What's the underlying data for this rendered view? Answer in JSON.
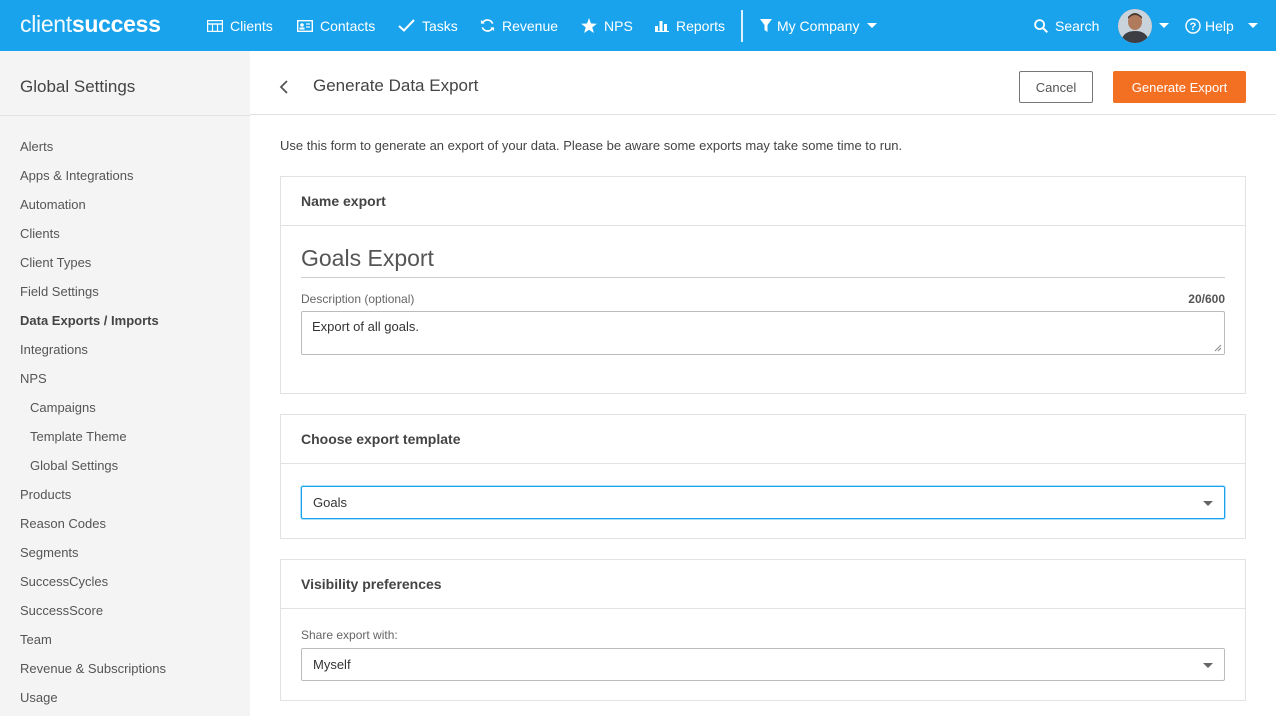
{
  "brand": {
    "part1": "client",
    "part2": "success"
  },
  "nav": {
    "clients": "Clients",
    "contacts": "Contacts",
    "tasks": "Tasks",
    "revenue": "Revenue",
    "nps": "NPS",
    "reports": "Reports",
    "company": "My Company",
    "search": "Search",
    "help": "Help"
  },
  "sidebar": {
    "title": "Global Settings",
    "items": [
      {
        "label": "Alerts"
      },
      {
        "label": "Apps & Integrations"
      },
      {
        "label": "Automation"
      },
      {
        "label": "Clients"
      },
      {
        "label": "Client Types"
      },
      {
        "label": "Field Settings"
      },
      {
        "label": "Data Exports / Imports",
        "active": true
      },
      {
        "label": "Integrations"
      },
      {
        "label": "NPS"
      },
      {
        "label": "Campaigns",
        "sub": true
      },
      {
        "label": "Template Theme",
        "sub": true
      },
      {
        "label": "Global Settings",
        "sub": true
      },
      {
        "label": "Products"
      },
      {
        "label": "Reason Codes"
      },
      {
        "label": "Segments"
      },
      {
        "label": "SuccessCycles"
      },
      {
        "label": "SuccessScore"
      },
      {
        "label": "Team"
      },
      {
        "label": "Revenue & Subscriptions"
      },
      {
        "label": "Usage"
      }
    ]
  },
  "header": {
    "title": "Generate Data Export",
    "cancel": "Cancel",
    "generate": "Generate Export"
  },
  "intro": "Use this form to generate an export of your data. Please be aware some exports may take some time to run.",
  "name_section": {
    "heading": "Name export",
    "name_value": "Goals Export",
    "description_label": "Description (optional)",
    "char_count": "20/600",
    "description_value": "Export of all goals."
  },
  "template_section": {
    "heading": "Choose export template",
    "selected": "Goals"
  },
  "visibility_section": {
    "heading": "Visibility preferences",
    "share_label": "Share export with:",
    "selected": "Myself"
  },
  "colors": {
    "topbar": "#1aa3ed",
    "primary_button": "#f36f21",
    "sidebar_bg": "#f4f4f4"
  }
}
